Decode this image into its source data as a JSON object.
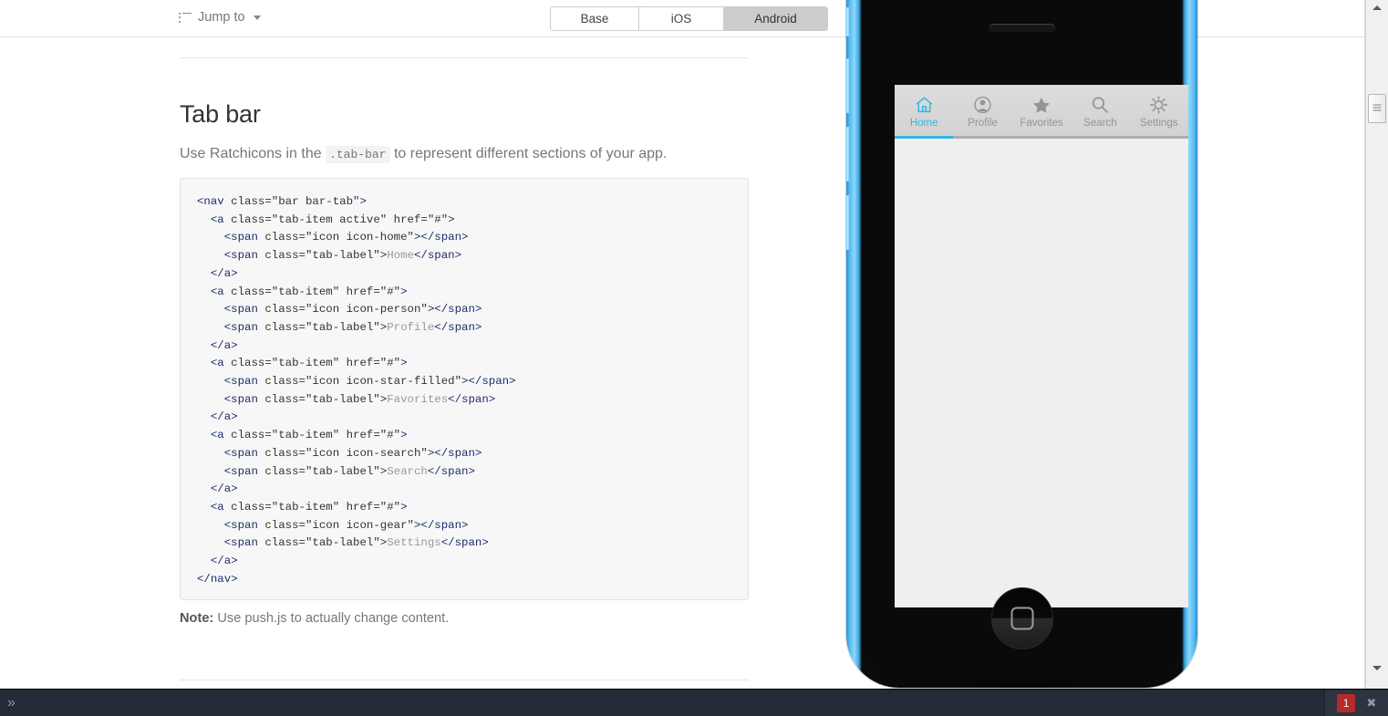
{
  "topbar": {
    "jump_to_label": "Jump to",
    "jump_to_icon": "list-icon",
    "caret_icon": "chevron-down-icon",
    "segmented": {
      "options": [
        "Base",
        "iOS",
        "Android"
      ],
      "selected": "Android"
    }
  },
  "doc": {
    "title": "Tab bar",
    "lede_before": "Use Ratchicons in the ",
    "lede_code": ".tab-bar",
    "lede_after": " to represent different sections of your app.",
    "code": "<nav class=\"bar bar-tab\">\n  <a class=\"tab-item active\" href=\"#\">\n    <span class=\"icon icon-home\"></span>\n    <span class=\"tab-label\">Home</span>\n  </a>\n  <a class=\"tab-item\" href=\"#\">\n    <span class=\"icon icon-person\"></span>\n    <span class=\"tab-label\">Profile</span>\n  </a>\n  <a class=\"tab-item\" href=\"#\">\n    <span class=\"icon icon-star-filled\"></span>\n    <span class=\"tab-label\">Favorites</span>\n  </a>\n  <a class=\"tab-item\" href=\"#\">\n    <span class=\"icon icon-search\"></span>\n    <span class=\"tab-label\">Search</span>\n  </a>\n  <a class=\"tab-item\" href=\"#\">\n    <span class=\"icon icon-gear\"></span>\n    <span class=\"tab-label\">Settings</span>\n  </a>\n</nav>",
    "note_label": "Note:",
    "note_text": " Use push.js to actually change content."
  },
  "preview": {
    "device": "iphone-5c-blue",
    "tabbar": {
      "items": [
        {
          "label": "Home",
          "icon": "home-icon",
          "active": true
        },
        {
          "label": "Profile",
          "icon": "person-icon",
          "active": false
        },
        {
          "label": "Favorites",
          "icon": "star-filled-icon",
          "active": false
        },
        {
          "label": "Search",
          "icon": "search-icon",
          "active": false
        },
        {
          "label": "Settings",
          "icon": "gear-icon",
          "active": false
        }
      ],
      "active_color": "#33b5e5",
      "inactive_color": "#949494",
      "background_color": "#d5d5d5"
    },
    "home_button_icon": "rounded-square-icon"
  },
  "console": {
    "expand_icon": "double-chevron-right-icon",
    "error_count": "1",
    "error_badge_color": "#b32b2b",
    "close_icon": "close-icon"
  },
  "scrollbar": {
    "up_icon": "triangle-up-icon",
    "down_icon": "triangle-down-icon"
  }
}
